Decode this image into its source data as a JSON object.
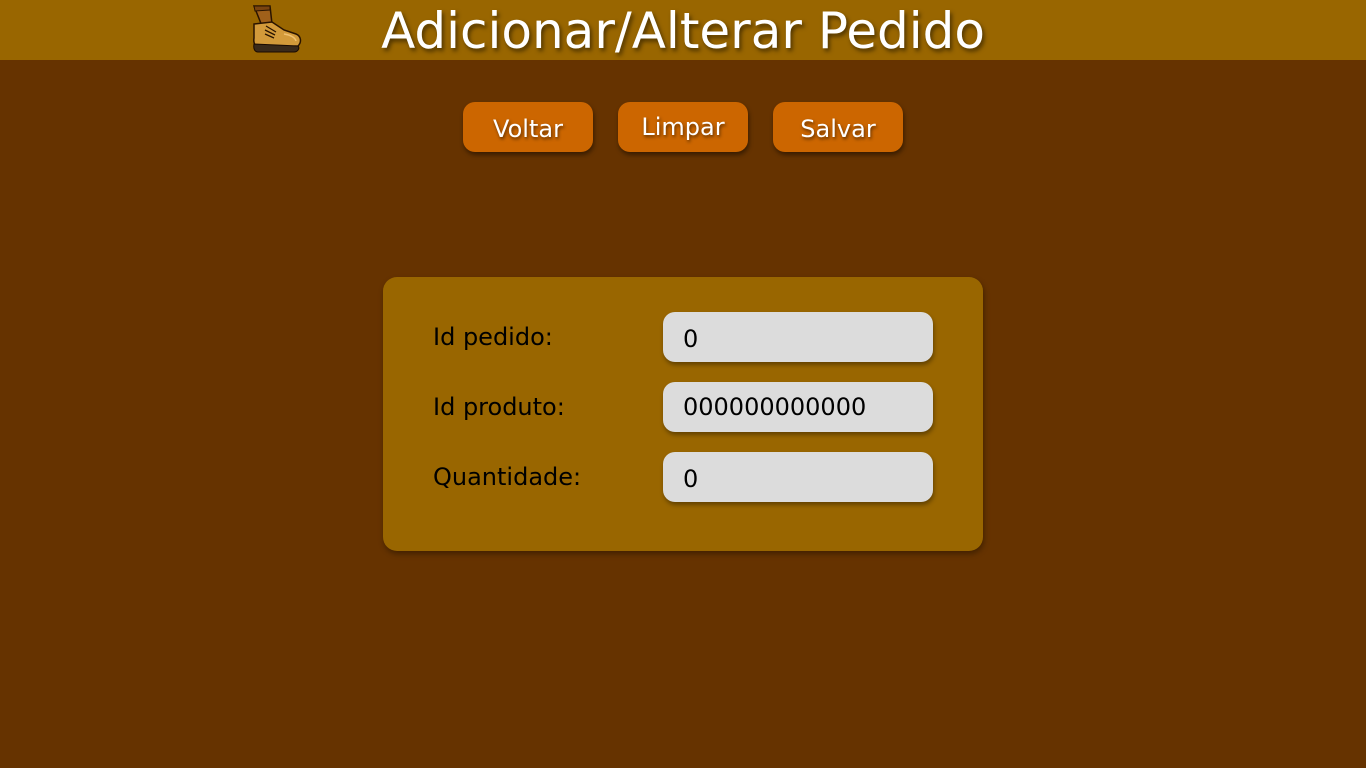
{
  "header": {
    "title": "Adicionar/Alterar Pedido",
    "logo_icon": "boot-icon",
    "background_color": "#996600"
  },
  "toolbar": {
    "back_label": "Voltar",
    "clear_label": "Limpar",
    "save_label": "Salvar",
    "button_color": "#cc6600"
  },
  "form": {
    "fields": [
      {
        "label": "Id pedido:",
        "value": "0"
      },
      {
        "label": "Id produto:",
        "value": "000000000000"
      },
      {
        "label": "Quantidade:",
        "value": "0"
      }
    ],
    "card_color": "#996600",
    "input_color": "#dcdcdc"
  },
  "page": {
    "background_color": "#663300"
  }
}
